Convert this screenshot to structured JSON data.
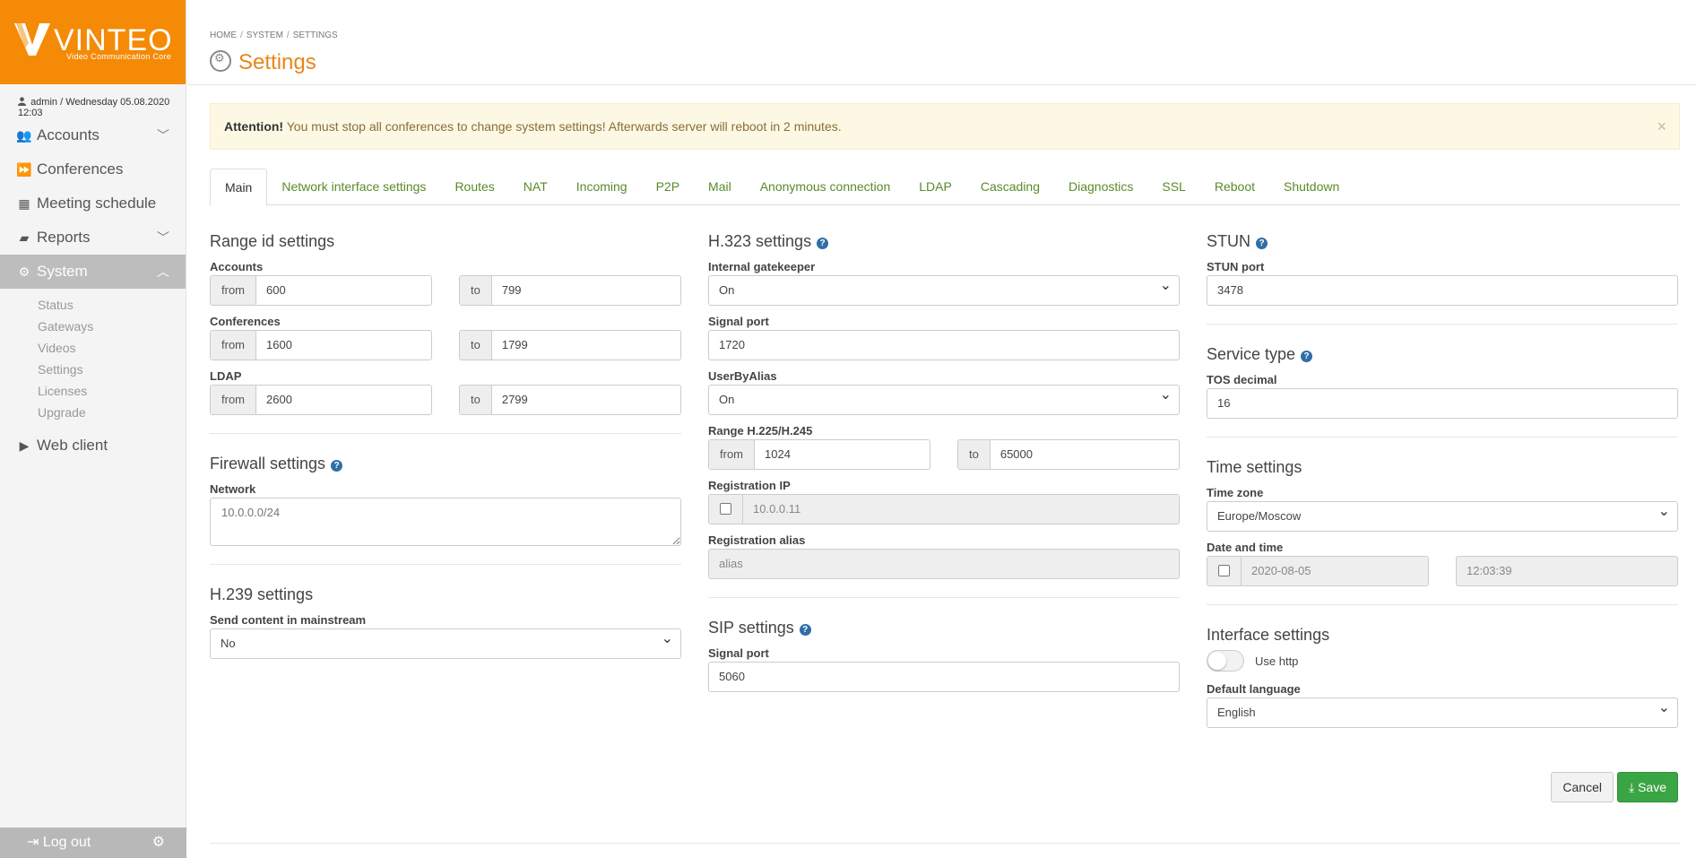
{
  "app": {
    "brand": "VINTEO",
    "tagline": "Video Communication Core"
  },
  "user_line": "admin / Wednesday 05.08.2020 12:03",
  "sidebar": {
    "items": [
      {
        "label": "Accounts"
      },
      {
        "label": "Conferences"
      },
      {
        "label": "Meeting schedule"
      },
      {
        "label": "Reports"
      },
      {
        "label": "System"
      },
      {
        "label": "Web client"
      }
    ],
    "subitems": [
      "Status",
      "Gateways",
      "Videos",
      "Settings",
      "Licenses",
      "Upgrade"
    ],
    "logout": "Log out"
  },
  "breadcrumb": [
    "HOME",
    "SYSTEM",
    "SETTINGS"
  ],
  "page_title": "Settings",
  "alert": {
    "strong": "Attention!",
    "text": " You must stop all conferences to change system settings! Afterwards server will reboot in 2 minutes.",
    "close": "×"
  },
  "tabs": [
    "Main",
    "Network interface settings",
    "Routes",
    "NAT",
    "Incoming",
    "P2P",
    "Mail",
    "Anonymous connection",
    "LDAP",
    "Cascading",
    "Diagnostics",
    "SSL",
    "Reboot",
    "Shutdown"
  ],
  "range": {
    "title": "Range id settings",
    "from": "from",
    "to": "to",
    "accounts": {
      "label": "Accounts",
      "from": "600",
      "to": "799"
    },
    "conferences": {
      "label": "Conferences",
      "from": "1600",
      "to": "1799"
    },
    "ldap": {
      "label": "LDAP",
      "from": "2600",
      "to": "2799"
    }
  },
  "firewall": {
    "title": "Firewall settings",
    "network_label": "Network",
    "network_placeholder": "10.0.0.0/24"
  },
  "h239": {
    "title": "H.239 settings",
    "label": "Send content in mainstream",
    "value": "No"
  },
  "h323": {
    "title": "H.323 settings",
    "gatekeeper_label": "Internal gatekeeper",
    "gatekeeper_value": "On",
    "signal_port_label": "Signal port",
    "signal_port_value": "1720",
    "userbyalias_label": "UserByAlias",
    "userbyalias_value": "On",
    "range_label": "Range H.225/H.245",
    "range_from": "1024",
    "range_to": "65000",
    "regip_label": "Registration IP",
    "regip_value": "10.0.0.11",
    "regalias_label": "Registration alias",
    "regalias_value": "alias"
  },
  "sip": {
    "title": "SIP settings",
    "signal_port_label": "Signal port",
    "signal_port_value": "5060"
  },
  "stun": {
    "title": "STUN",
    "port_label": "STUN port",
    "port_value": "3478"
  },
  "service": {
    "title": "Service type",
    "tos_label": "TOS decimal",
    "tos_value": "16"
  },
  "time": {
    "title": "Time settings",
    "tz_label": "Time zone",
    "tz_value": "Europe/Moscow",
    "dt_label": "Date and time",
    "date_value": "2020-08-05",
    "time_value": "12:03:39"
  },
  "interface": {
    "title": "Interface settings",
    "use_http": "Use http",
    "lang_label": "Default language",
    "lang_value": "English"
  },
  "buttons": {
    "cancel": "Cancel",
    "save": "Save"
  },
  "colors": {
    "brand": "#f48a05",
    "title": "#e8861a",
    "tab_link": "#5a8a2a",
    "save": "#3aa544"
  }
}
